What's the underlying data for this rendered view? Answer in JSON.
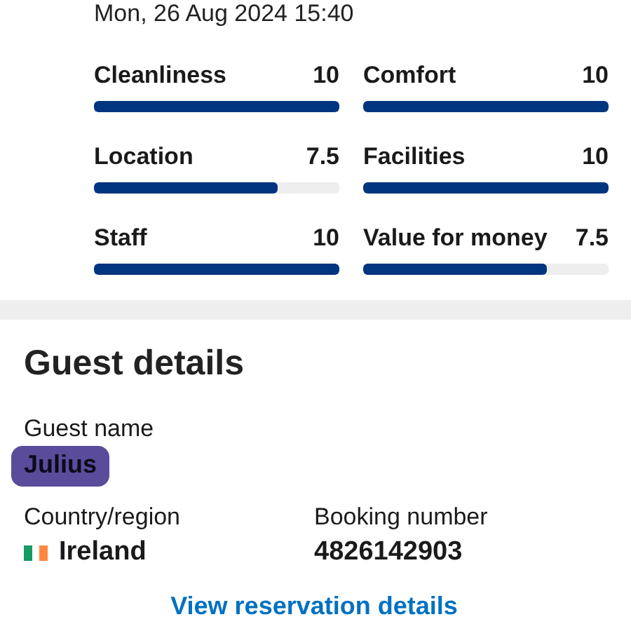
{
  "review_date": "Mon, 26 Aug 2024 15:40",
  "ratings": [
    {
      "label": "Cleanliness",
      "score": "10",
      "level": 1
    },
    {
      "label": "Comfort",
      "score": "10",
      "level": 1
    },
    {
      "label": "Location",
      "score": "7.5",
      "level": 0.75
    },
    {
      "label": "Facilities",
      "score": "10",
      "level": 1
    },
    {
      "label": "Staff",
      "score": "10",
      "level": 1
    },
    {
      "label": "Value for money",
      "score": "7.5",
      "level": 0.75
    }
  ],
  "guest_details": {
    "title": "Guest details",
    "guest_name_label": "Guest name",
    "guest_name": "Julius",
    "country_label": "Country/region",
    "country": "Ireland",
    "booking_label": "Booking number",
    "booking_number": "4826142903"
  },
  "link": "View reservation details"
}
